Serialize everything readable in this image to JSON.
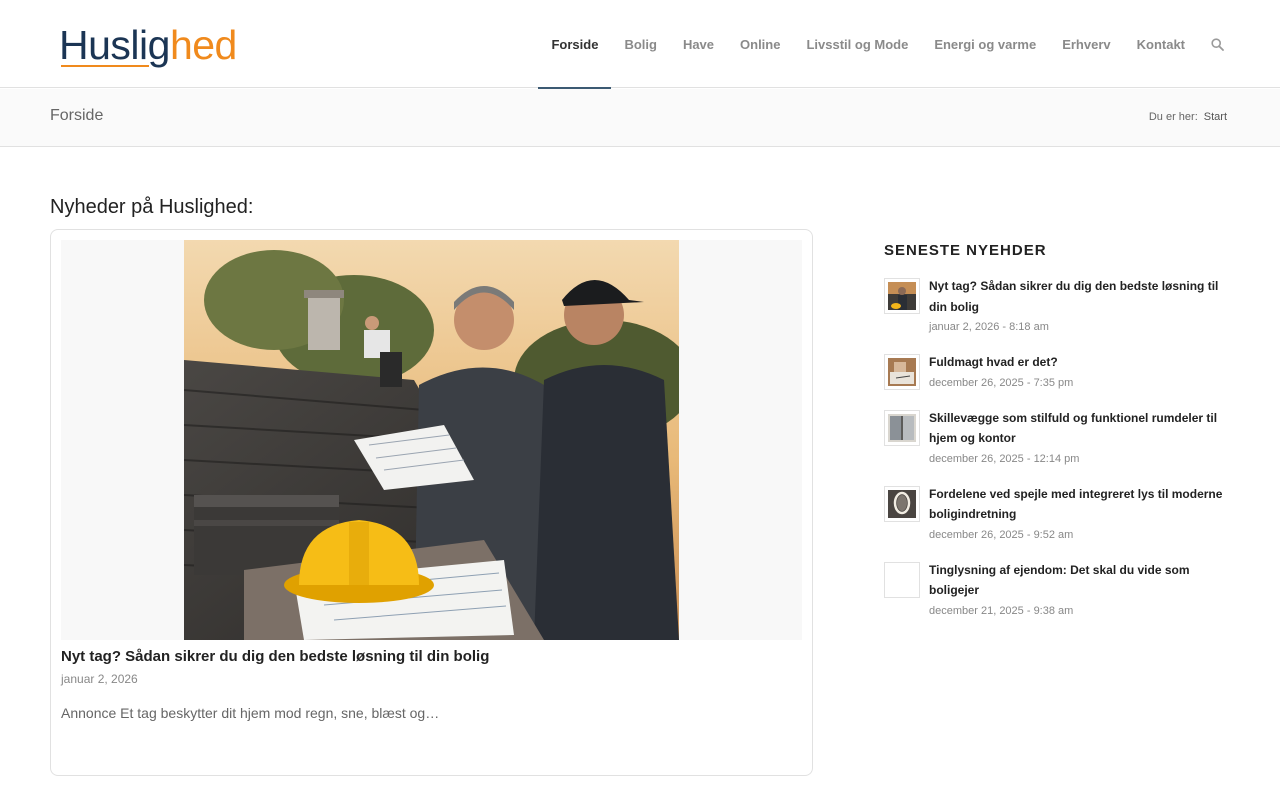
{
  "brand": {
    "name_part1": "Huslig",
    "name_part2": "hed"
  },
  "nav": {
    "items": [
      {
        "label": "Forside",
        "active": true
      },
      {
        "label": "Bolig",
        "active": false
      },
      {
        "label": "Have",
        "active": false
      },
      {
        "label": "Online",
        "active": false
      },
      {
        "label": "Livsstil og Mode",
        "active": false
      },
      {
        "label": "Energi og varme",
        "active": false
      },
      {
        "label": "Erhverv",
        "active": false
      },
      {
        "label": "Kontakt",
        "active": false
      }
    ],
    "search_icon": "search-icon"
  },
  "titlebar": {
    "title": "Forside",
    "breadcrumb_prefix": "Du er her:",
    "breadcrumb_current": "Start"
  },
  "main": {
    "heading": "Nyheder på Huslighed:",
    "featured": {
      "title": "Nyt tag? Sådan sikrer du dig den bedste løsning til din bolig",
      "date": "januar 2, 2026",
      "excerpt": "Annonce Et tag beskytter dit hjem mod regn, sne, blæst og…"
    }
  },
  "sidebar": {
    "heading": "SENESTE NYEHDER",
    "items": [
      {
        "title": "Nyt tag? Sådan sikrer du dig den bedste løsning til din bolig",
        "date": "januar 2, 2026 - 8:18 am"
      },
      {
        "title": "Fuldmagt hvad er det?",
        "date": "december 26, 2025 - 7:35 pm"
      },
      {
        "title": "Skillevægge som stilfuld og funktionel rumdeler til hjem og kontor",
        "date": "december 26, 2025 - 12:14 pm"
      },
      {
        "title": "Fordelene ved spejle med integreret lys til moderne boligindretning",
        "date": "december 26, 2025 - 9:52 am"
      },
      {
        "title": "Tinglysning af ejendom: Det skal du vide som boligejer",
        "date": "december 21, 2025 - 9:38 am"
      }
    ]
  },
  "colors": {
    "brand_dark": "#1b3554",
    "brand_orange": "#f08a1d",
    "active_nav_underline": "#3c5a73"
  }
}
